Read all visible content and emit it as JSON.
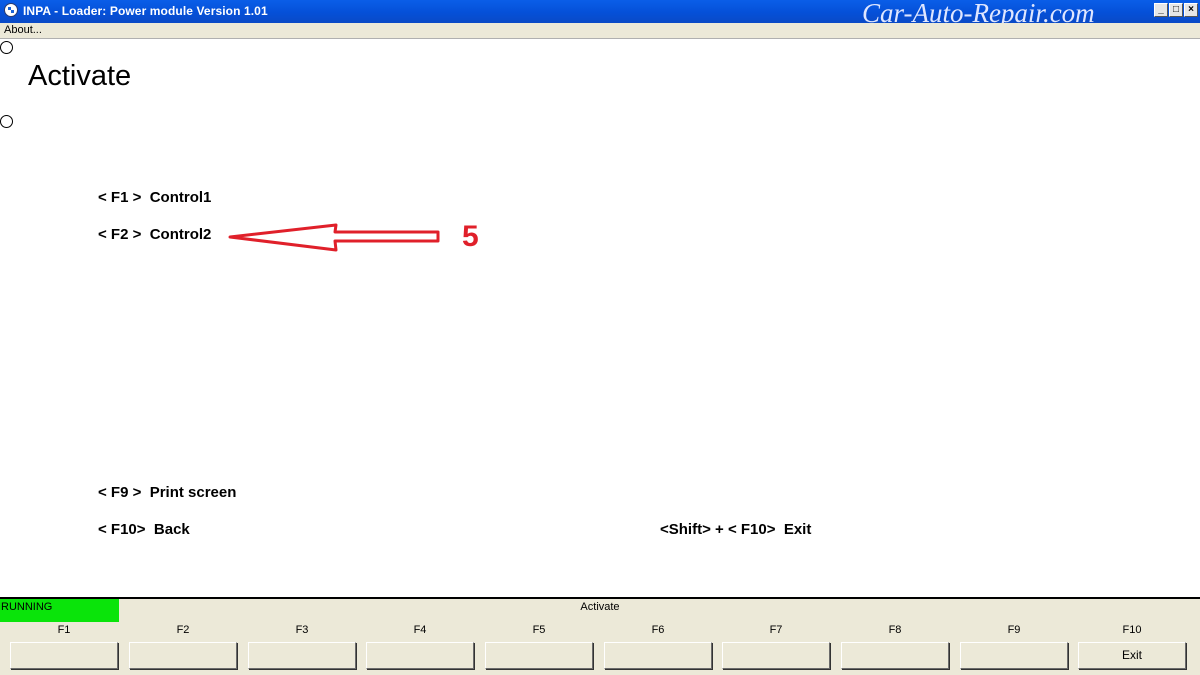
{
  "window": {
    "title": "INPA - Loader:  Power module Version 1.01",
    "watermark": "Car-Auto-Repair.com",
    "minimize": "_",
    "maximize": "□",
    "close": "×"
  },
  "menu": {
    "about": "About..."
  },
  "main": {
    "heading": "Activate",
    "items": [
      {
        "key": "< F1 >",
        "label": "Control1"
      },
      {
        "key": "< F2 >",
        "label": "Control2"
      },
      {
        "key": "< F9 >",
        "label": "Print screen"
      },
      {
        "key": "< F10>",
        "label": "Back"
      }
    ],
    "exit_item": {
      "key": "<Shift> + < F10>",
      "label": "Exit"
    },
    "annotation": {
      "number": "5",
      "color": "#e0202a"
    }
  },
  "statusbar": {
    "state": "RUNNING",
    "state_color": "#0ae40a",
    "title": "Activate"
  },
  "function_keys": [
    {
      "label": "F1",
      "button": ""
    },
    {
      "label": "F2",
      "button": ""
    },
    {
      "label": "F3",
      "button": ""
    },
    {
      "label": "F4",
      "button": ""
    },
    {
      "label": "F5",
      "button": ""
    },
    {
      "label": "F6",
      "button": ""
    },
    {
      "label": "F7",
      "button": ""
    },
    {
      "label": "F8",
      "button": ""
    },
    {
      "label": "F9",
      "button": ""
    },
    {
      "label": "F10",
      "button": "Exit"
    }
  ]
}
